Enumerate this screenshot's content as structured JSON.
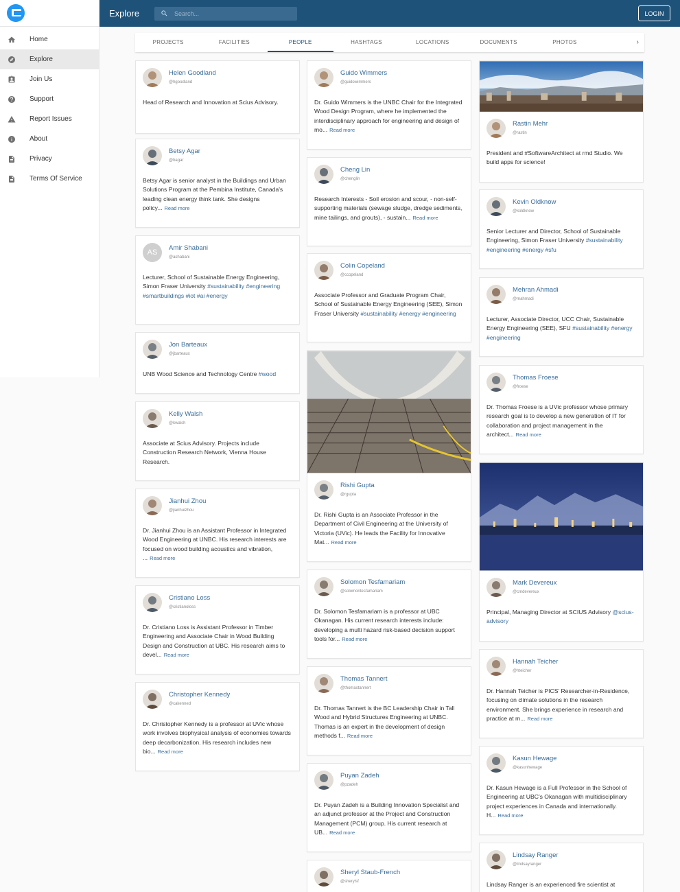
{
  "sidebar": {
    "items": [
      {
        "label": "Home",
        "icon": "home-icon",
        "active": false
      },
      {
        "label": "Explore",
        "icon": "compass-icon",
        "active": true
      },
      {
        "label": "Join Us",
        "icon": "badge-icon",
        "active": false
      },
      {
        "label": "Support",
        "icon": "help-icon",
        "active": false
      },
      {
        "label": "Report Issues",
        "icon": "warning-icon",
        "active": false
      },
      {
        "label": "About",
        "icon": "info-icon",
        "active": false
      },
      {
        "label": "Privacy",
        "icon": "document-icon",
        "active": false
      },
      {
        "label": "Terms Of Service",
        "icon": "document-icon",
        "active": false
      }
    ]
  },
  "header": {
    "title": "Explore",
    "search_placeholder": "Search...",
    "login_label": "LOGIN"
  },
  "tabs": [
    "PROJECTS",
    "FACILITIES",
    "PEOPLE",
    "HASHTAGS",
    "LOCATIONS",
    "DOCUMENTS",
    "PHOTOS"
  ],
  "active_tab": "PEOPLE",
  "colors": {
    "header_bg": "#1f5279",
    "accent": "#3a6d99",
    "sidebar_active": "#e9e9e9"
  },
  "read_more_label": "Read more",
  "people": {
    "col1": [
      {
        "name": "Helen Goodland",
        "handle": "@hgoodland",
        "bio": "Head of Research and Innovation at Scius Advisory.",
        "tags": "",
        "read_more": false
      },
      {
        "name": "Betsy Agar",
        "handle": "@bagar",
        "bio": "Betsy Agar is senior analyst in the Buildings and Urban Solutions Program at the Pembina Institute, Canada's leading clean energy think tank. She designs policy...",
        "tags": "",
        "read_more": true
      },
      {
        "name": "Amir Shabani",
        "handle": "@ashabani",
        "initials": "AS",
        "bio": "Lecturer, School of Sustainable Energy Engineering, Simon Fraser University ",
        "tags": "#sustainability #engineering #smartbuildings #iot #ai #energy",
        "read_more": false
      },
      {
        "name": "Jon Barteaux",
        "handle": "@jbarteaux",
        "bio": "UNB Wood Science and Technology Centre ",
        "tags": "#wood",
        "read_more": false
      },
      {
        "name": "Kelly Walsh",
        "handle": "@kwalsh",
        "bio": "Associate at Scius Advisory. Projects include Construction Research Network, Vienna House Research.",
        "tags": "",
        "read_more": false
      },
      {
        "name": "Jianhui Zhou",
        "handle": "@jianhuizhou",
        "bio": "Dr. Jianhui Zhou is an Assistant Professor in Integrated Wood Engineering at UNBC. His research interests are focused on wood building acoustics and vibration, ...",
        "tags": "",
        "read_more": true
      },
      {
        "name": "Cristiano Loss",
        "handle": "@cristianoloss",
        "bio": "Dr. Cristiano Loss is Assistant Professor in Timber Engineering and Associate Chair in Wood Building Design and Construction at UBC. His research aims to devel...",
        "tags": "",
        "read_more": true
      },
      {
        "name": "Christopher Kennedy",
        "handle": "@cakenned",
        "bio": "Dr. Christopher Kennedy is a professor at UVic whose work involves biophysical analysis of economies towards deep decarbonization. His research includes new bio...",
        "tags": "",
        "read_more": true
      }
    ],
    "col2": [
      {
        "name": "Guido Wimmers",
        "handle": "@guidowimmers",
        "bio": "Dr. Guido Wimmers is the UNBC Chair for the Integrated Wood Design Program, where he implemented the interdisciplinary approach for engineering and design of mo...",
        "tags": "",
        "read_more": true
      },
      {
        "name": "Cheng Lin",
        "handle": "@chenglin",
        "bio": "Research Interests - Soil erosion and scour, - non-self-supporting materials (sewage sludge, dredge sediments, mine tailings, and grouts), - sustain...",
        "tags": "",
        "read_more": true
      },
      {
        "name": "Colin Copeland",
        "handle": "@ccopeland",
        "bio": "Associate Professor and Graduate Program Chair, School of Sustainable Energy Engineering (SEE), Simon Fraser University ",
        "tags": "#sustainability #energy #engineering",
        "read_more": false
      },
      {
        "name": "Rishi Gupta",
        "handle": "@rgupta",
        "bio": "Dr. Rishi Gupta is an Associate Professor in the Department of Civil Engineering at the University of Victoria (UVic). He leads the Facility for Innovative Mat...",
        "tags": "",
        "read_more": true
      },
      {
        "name": "Solomon Tesfamariam",
        "handle": "@solomontesfamariam",
        "bio": "Dr. Solomon Tesfamariam is a professor at UBC Okanagan. His current research interests include: developing a multi hazard risk-based decision support tools for...",
        "tags": "",
        "read_more": true
      },
      {
        "name": "Thomas Tannert",
        "handle": "@thomastannert",
        "bio": "Dr. Thomas Tannert is the BC Leadership Chair in Tall Wood and Hybrid Structures Engineering at UNBC. Thomas is an expert in the development of design methods f...",
        "tags": "",
        "read_more": true
      },
      {
        "name": "Puyan Zadeh",
        "handle": "@pzadeh",
        "bio": "Dr. Puyan Zadeh is a Building Innovation Specialist and an adjunct professor at the Project and Construction Management (PCM) group. His current research at UB...",
        "tags": "",
        "read_more": true
      },
      {
        "name": "Sheryl Staub-French",
        "handle": "@sherylsf",
        "bio": "",
        "tags": "",
        "read_more": false
      }
    ],
    "col3": [
      {
        "name": "Rastin Mehr",
        "handle": "@rastin",
        "bio": "President and #SoftwareArchitect at rmd Studio. We build apps for science!",
        "tags": "",
        "read_more": false
      },
      {
        "name": "Kevin Oldknow",
        "handle": "@koldknow",
        "bio": "Senior Lecturer and Director, School of Sustainable Engineering, Simon Fraser University ",
        "tags": "#sustainability #engineering #energy #sfu",
        "read_more": false
      },
      {
        "name": "Mehran Ahmadi",
        "handle": "@mahmadi",
        "bio": "Lecturer, Associate Director, UCC Chair, Sustainable Energy Engineering (SEE), SFU ",
        "tags": "#sustainability #energy #engineering",
        "read_more": false
      },
      {
        "name": "Thomas Froese",
        "handle": "@froese",
        "bio": "Dr. Thomas Froese is a UVic professor whose primary research goal is to develop a new generation of IT for collaboration and project management in the architect...",
        "tags": "",
        "read_more": true
      },
      {
        "name": "Mark Devereux",
        "handle": "@cmdevereux",
        "bio": "Principal, Managing Director at SCIUS Advisory ",
        "tags": "@scius-advisory",
        "read_more": false
      },
      {
        "name": "Hannah Teicher",
        "handle": "@hteicher",
        "bio": "Dr. Hannah Teicher is PICS' Researcher-in-Residence, focusing on climate solutions in the research environment. She brings experience in research and practice at m...",
        "tags": "",
        "read_more": true
      },
      {
        "name": "Kasun Hewage",
        "handle": "@kasunhewage",
        "bio": "Dr. Kasun Hewage is a Full Professor in the School of Engineering at UBC's Okanagan with multidisciplinary project experiences in Canada and internationally. H...",
        "tags": "",
        "read_more": true
      },
      {
        "name": "Lindsay Ranger",
        "handle": "@lindsayranger",
        "bio": "Lindsay Ranger is an experienced fire scientist at",
        "tags": "",
        "read_more": false
      }
    ]
  }
}
